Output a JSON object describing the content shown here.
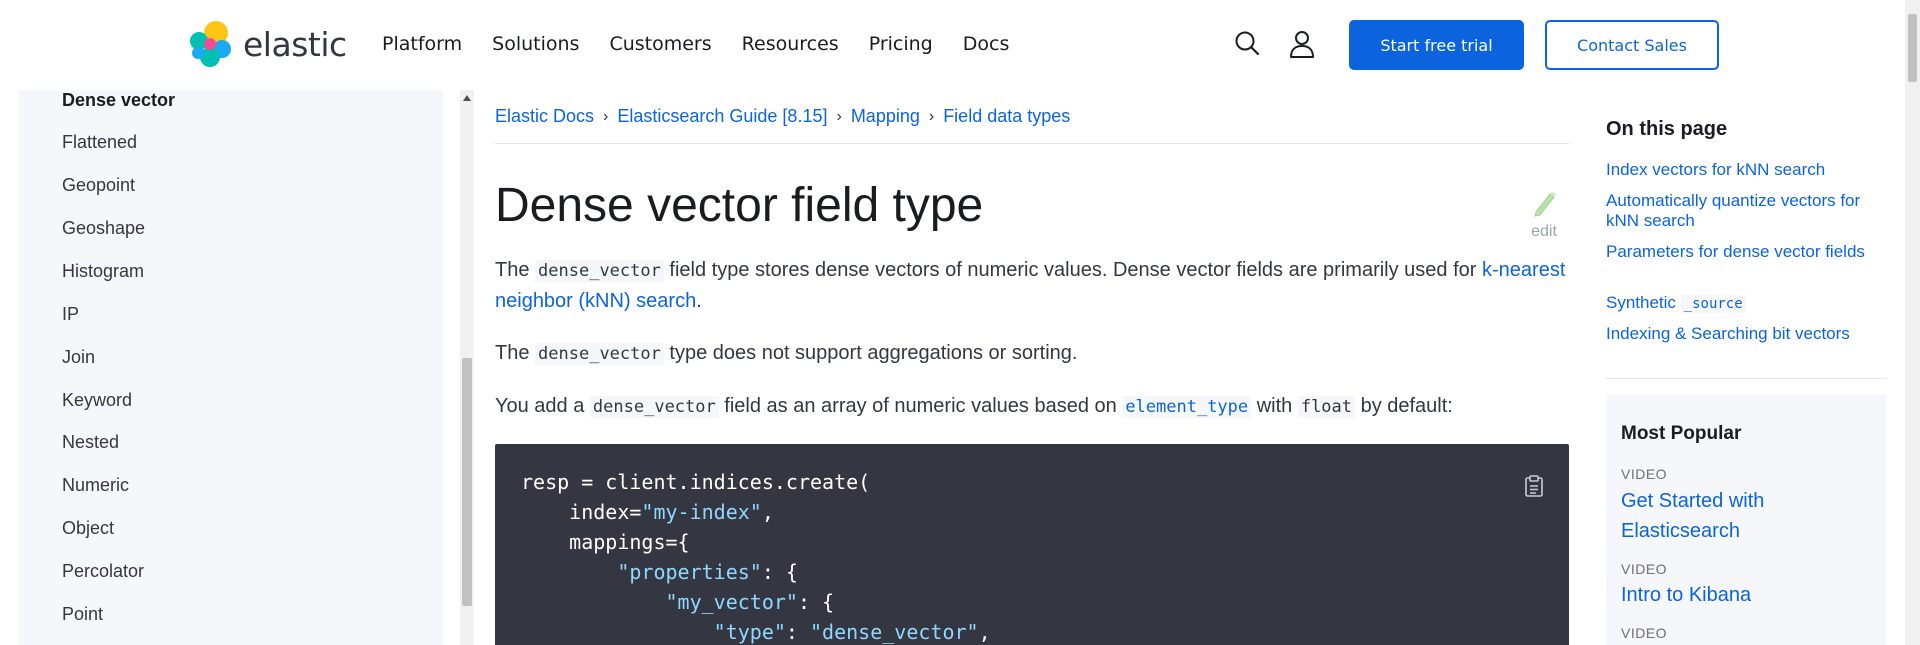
{
  "header": {
    "logo_text": "elastic",
    "nav": [
      "Platform",
      "Solutions",
      "Customers",
      "Resources",
      "Pricing",
      "Docs"
    ],
    "search_icon": "search-icon",
    "user_icon": "user-icon",
    "trial_button": "Start free trial",
    "contact_button": "Contact Sales"
  },
  "sidebar": {
    "items": [
      {
        "label": "Dense vector",
        "active": true
      },
      {
        "label": "Flattened"
      },
      {
        "label": "Geopoint"
      },
      {
        "label": "Geoshape"
      },
      {
        "label": "Histogram"
      },
      {
        "label": "IP"
      },
      {
        "label": "Join"
      },
      {
        "label": "Keyword"
      },
      {
        "label": "Nested"
      },
      {
        "label": "Numeric"
      },
      {
        "label": "Object"
      },
      {
        "label": "Percolator"
      },
      {
        "label": "Point"
      }
    ]
  },
  "breadcrumb": [
    "Elastic Docs",
    "Elasticsearch Guide [8.15]",
    "Mapping",
    "Field data types"
  ],
  "breadcrumb_sep": "›",
  "content": {
    "title": "Dense vector field type",
    "edit_label": "edit",
    "p1": {
      "t1": "The ",
      "code": "dense_vector",
      "t2": " field type stores dense vectors of numeric values. Dense vector fields are primarily used for ",
      "link": "k-nearest neighbor (kNN) search",
      "t3": "."
    },
    "p2": {
      "t1": "The ",
      "code": "dense_vector",
      "t2": " type does not support aggregations or sorting."
    },
    "p3": {
      "t1": "You add a ",
      "code1": "dense_vector",
      "t2": " field as an array of numeric values based on ",
      "code_link": "element_type",
      "t3": " with ",
      "code2": "float",
      "t4": " by default:"
    },
    "code_lines": [
      {
        "plain": "resp = client.indices.create("
      },
      {
        "plain": "    index=",
        "str": "\"my-index\"",
        "tail": ","
      },
      {
        "plain": "    mappings={"
      },
      {
        "plain": "        ",
        "str": "\"properties\"",
        "tail": ": {"
      },
      {
        "plain": "            ",
        "str": "\"my_vector\"",
        "tail": ": {"
      },
      {
        "plain": "                ",
        "str": "\"type\"",
        "tail": ": ",
        "str2": "\"dense_vector\"",
        "tail2": ","
      }
    ],
    "copy_icon": "clipboard-icon"
  },
  "toc": {
    "title": "On this page",
    "links": [
      {
        "label": "Index vectors for kNN search"
      },
      {
        "label": "Automatically quantize vectors for kNN search"
      },
      {
        "label": "Parameters for dense vector fields"
      },
      {
        "label": "Synthetic ",
        "code": "_source"
      },
      {
        "label": "Indexing & Searching bit vectors"
      }
    ]
  },
  "popular": {
    "title": "Most Popular",
    "items": [
      {
        "tag": "VIDEO",
        "label": "Get Started with Elasticsearch"
      },
      {
        "tag": "VIDEO",
        "label": "Intro to Kibana"
      },
      {
        "tag": "VIDEO",
        "label": ""
      }
    ]
  },
  "colors": {
    "accent": "#0b64dd",
    "code_bg": "#343741",
    "code_string": "#8fd8ff",
    "sidebar_bg": "#f5f7fa"
  }
}
